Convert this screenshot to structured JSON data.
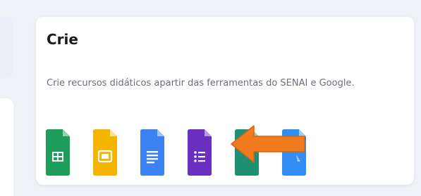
{
  "card": {
    "title": "Crie",
    "description": "Crie recursos didáticos apartir das ferramentas do SENAI e Google."
  },
  "tools": [
    {
      "name": "google-sheets-icon",
      "color": "#1e9e5a",
      "fold": "#8fd3a8",
      "glyph": "⊞"
    },
    {
      "name": "google-slides-icon",
      "color": "#f5b400",
      "fold": "#fbe08a",
      "glyph": "▭"
    },
    {
      "name": "google-docs-icon",
      "color": "#3b82f0",
      "fold": "#9ec1f7",
      "glyph": "≡"
    },
    {
      "name": "google-forms-icon",
      "color": "#6a2fc0",
      "fold": "#b69be0",
      "glyph": "☰"
    },
    {
      "name": "google-sites-icon",
      "color": "#1f8f71",
      "fold": "#93cfbd",
      "glyph": ""
    },
    {
      "name": "google-drawings-icon",
      "color": "#2f8df5",
      "fold": "#9ecbfa",
      "glyph": ""
    }
  ],
  "colors": {
    "arrow": "#f07a1e",
    "background": "#eef1f6",
    "card": "#ffffff"
  }
}
